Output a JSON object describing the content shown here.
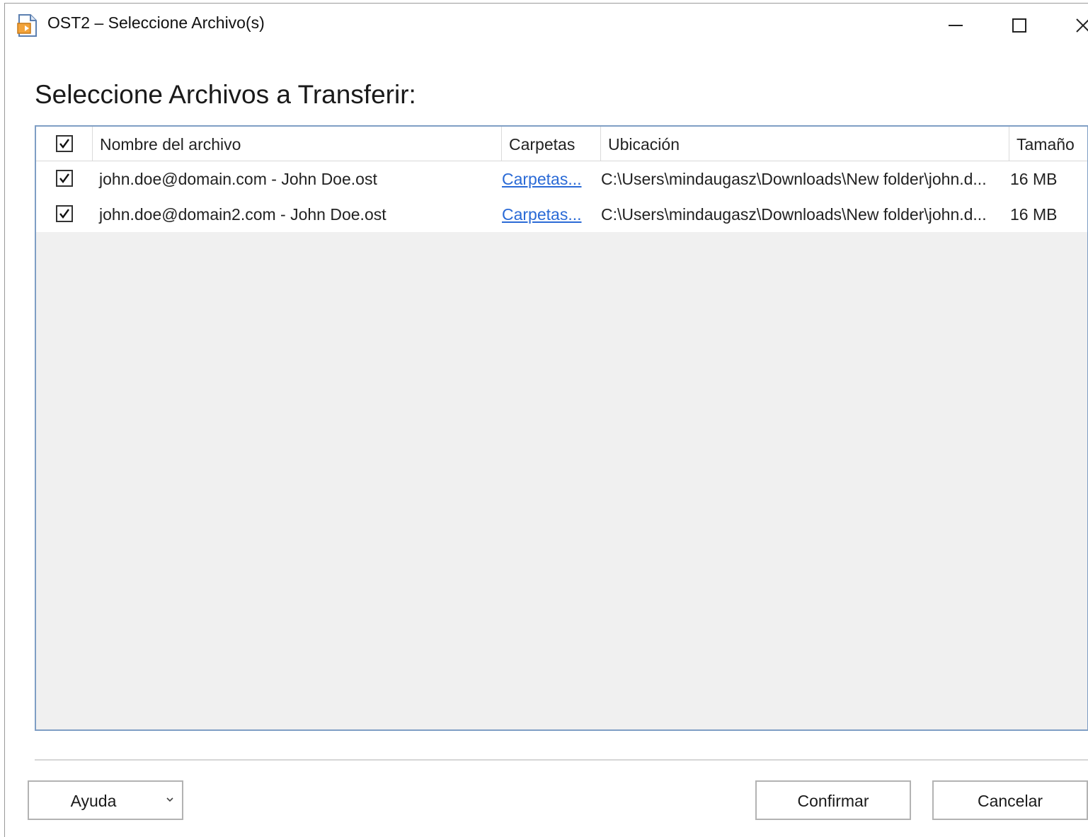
{
  "window": {
    "title": "OST2 – Seleccione Archivo(s)",
    "app_icon": "document-transfer-icon"
  },
  "heading": "Seleccione Archivos a Transferir:",
  "table": {
    "columns": [
      "Nombre del archivo",
      "Carpetas",
      "Ubicación",
      "Tamaño"
    ],
    "select_all_checked": true,
    "rows": [
      {
        "checked": true,
        "file_name": "john.doe@domain.com - John Doe.ost",
        "folders_link": "Carpetas...",
        "location": "C:\\Users\\mindaugasz\\Downloads\\New folder\\john.d...",
        "size": "16 MB"
      },
      {
        "checked": true,
        "file_name": "john.doe@domain2.com - John Doe.ost",
        "folders_link": "Carpetas...",
        "location": "C:\\Users\\mindaugasz\\Downloads\\New folder\\john.d...",
        "size": "16 MB"
      }
    ]
  },
  "buttons": {
    "help": "Ayuda",
    "confirm": "Confirmar",
    "cancel": "Cancelar"
  },
  "colors": {
    "grid_border": "#7f9ec4",
    "link": "#2a6ad6",
    "empty_area": "#f0f0f0"
  }
}
